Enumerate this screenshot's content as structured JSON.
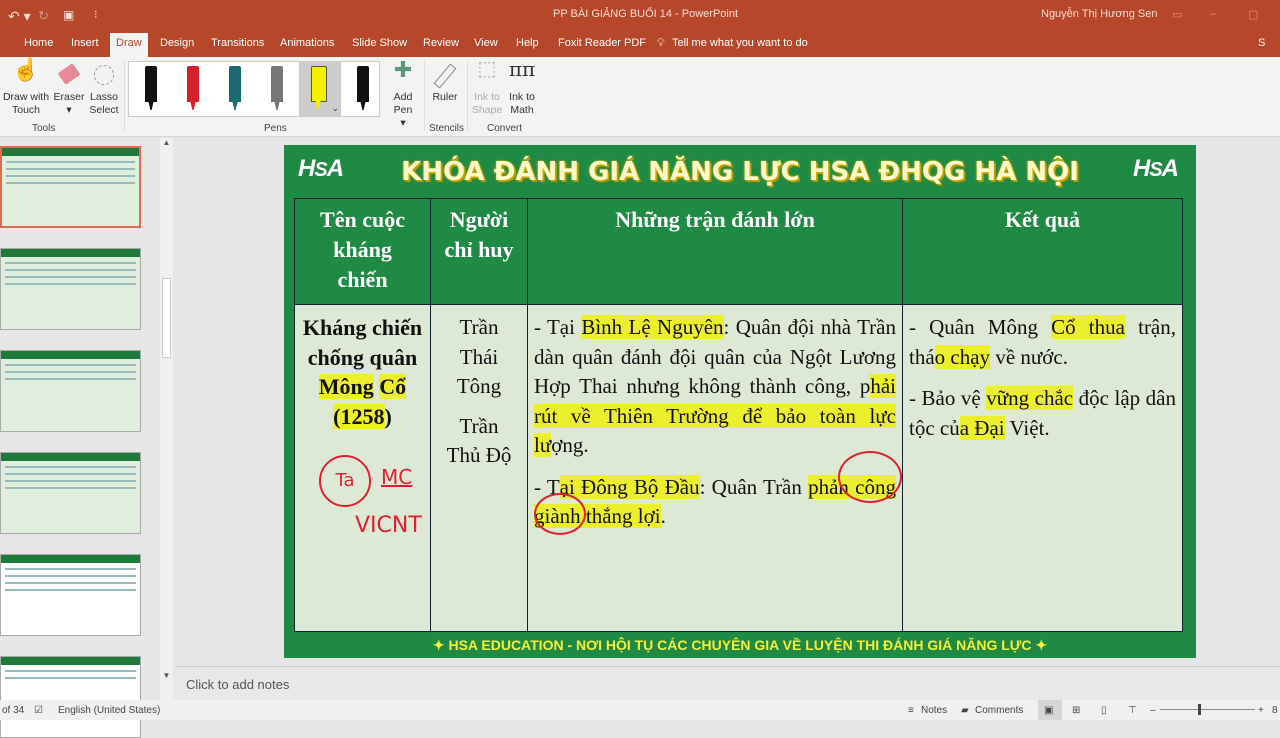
{
  "window": {
    "title": "PP BÀI GIẢNG BUỔI 14  -  PowerPoint",
    "user": "Nguyễn Thị Hương Sen"
  },
  "tabs": [
    "Home",
    "Insert",
    "Draw",
    "Design",
    "Transitions",
    "Animations",
    "Slide Show",
    "Review",
    "View",
    "Help",
    "Foxit Reader PDF"
  ],
  "tell_me": "Tell me what you want to do",
  "share": "S",
  "ribbon": {
    "draw_with_touch": "Draw with Touch",
    "eraser": "Eraser",
    "lasso": "Lasso Select",
    "add_pen": "Add Pen",
    "ruler": "Ruler",
    "ink_to_shape": "Ink to Shape",
    "ink_to_math": "Ink to Math",
    "groups": {
      "tools": "Tools",
      "pens": "Pens",
      "stencils": "Stencils",
      "convert": "Convert"
    },
    "pen_colors": [
      "#111111",
      "#d8202a",
      "#1a6a70",
      "#777777",
      "#f4f000",
      "#111111"
    ]
  },
  "slide": {
    "logo": "HSA",
    "title": "KHÓA ĐÁNH GIÁ NĂNG LỰC HSA ĐHQG HÀ NỘI",
    "headers": [
      "Tên cuộc kháng chiến",
      "Người chỉ huy",
      "Những trận đánh lớn",
      "Kết quả"
    ],
    "war": {
      "a": "Kháng chiến chống quân ",
      "b": "Mông",
      "c": " ",
      "d": "Cổ (1258",
      "e": ")"
    },
    "commander1": "Trần Thái Tông",
    "commander2": "Trần Thủ Độ",
    "battle1": {
      "a": "- Tại ",
      "b": "Bình Lệ Nguyên",
      "c": ": Quân đội nhà Trần dàn quân đánh đội quân của Ngột Lương Hợp Thai nhưng không thành công, p",
      "d": "hải rút về Thiên Trường để bảo toàn lực lư",
      "e": "ợng."
    },
    "battle2": {
      "a": "- T",
      "b": "ại Đông Bộ Đầu",
      "c": ": Quân Trần ",
      "d": "phản công giành thắng lợi",
      "e": "."
    },
    "result1": {
      "a": "- Quân Mông ",
      "b": "Cổ thua",
      "c": " trận, thá",
      "d": "o chạy",
      "e": " về nước."
    },
    "result2": {
      "a": "- Bảo vệ ",
      "b": "vững chắc",
      "c": " độc lập dân tộc củ",
      "d": "a Đại",
      "e": " Việt."
    },
    "handwriting": {
      "a": "Ta",
      "b": "MC",
      "c": "VICNT"
    },
    "footer": "✦ HSA EDUCATION - NƠI HỘI TỤ CÁC CHUYÊN GIA VỀ LUYỆN THI ĐÁNH GIÁ NĂNG LỰC ✦"
  },
  "notes_placeholder": "Click to add notes",
  "status": {
    "slide": "of 34",
    "language": "English (United States)",
    "notes": "Notes",
    "comments": "Comments",
    "zoom": "8"
  }
}
